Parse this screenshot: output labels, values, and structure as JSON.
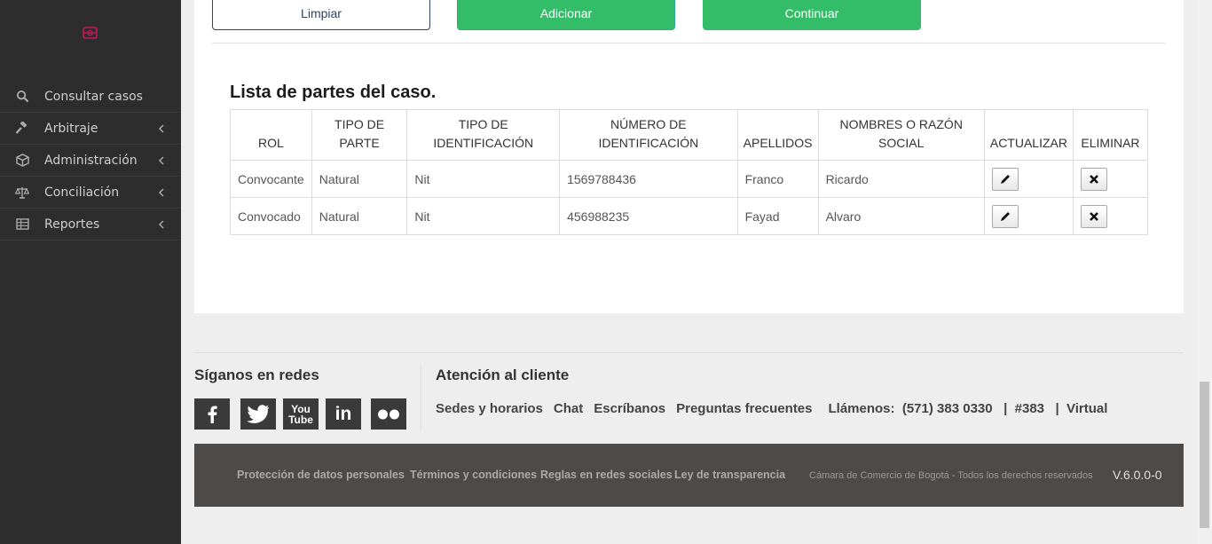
{
  "sidebar": {
    "items": [
      {
        "label": "Consultar casos",
        "icon": "search-icon"
      },
      {
        "label": "Arbitraje",
        "icon": "gavel-icon"
      },
      {
        "label": "Administración",
        "icon": "cube-icon"
      },
      {
        "label": "Conciliación",
        "icon": "scale-icon"
      },
      {
        "label": "Reportes",
        "icon": "table-icon"
      }
    ]
  },
  "actions": {
    "limpiar": "Limpiar",
    "adicionar": "Adicionar",
    "continuar": "Continuar"
  },
  "parts": {
    "title": "Lista de partes del caso.",
    "headers": {
      "rol": "ROL",
      "tipo_parte": "TIPO DE PARTE",
      "tipo_id": "TIPO DE IDENTIFICACIÓN",
      "numero_id": "NÚMERO DE IDENTIFICACIÓN",
      "apellidos": "APELLIDOS",
      "nombres": "NOMBRES O RAZÓN SOCIAL",
      "actualizar": "ACTUALIZAR",
      "eliminar": "ELIMINAR"
    },
    "rows": [
      {
        "rol": "Convocante",
        "tipo_parte": "Natural",
        "tipo_id": "Nit",
        "numero_id": "1569788436",
        "apellidos": "Franco",
        "nombres": "Ricardo"
      },
      {
        "rol": "Convocado",
        "tipo_parte": "Natural",
        "tipo_id": "Nit",
        "numero_id": "456988235",
        "apellidos": "Fayad",
        "nombres": "Alvaro"
      }
    ]
  },
  "footer": {
    "social_title": "Síganos en redes",
    "attention_title": "Atención al cliente",
    "social": [
      "facebook-icon",
      "twitter-icon",
      "youtube-icon",
      "linkedin-icon",
      "flickr-icon"
    ],
    "links": {
      "sedes": "Sedes y horarios",
      "chat": "Chat",
      "escribanos": "Escríbanos",
      "preguntas": "Preguntas frecuentes",
      "llamenos": "Llámenos:  (571) 383 0330   |  #383   |  Virtual"
    },
    "legal": {
      "proteccion": "Protección de datos personales",
      "terminos": "Términos y condiciones",
      "reglas": "Reglas en redes sociales",
      "transparencia": "Ley de transparencia"
    },
    "rights": "Cámara de Comercio de Bogotá - Todos los derechos reservados",
    "version": "V.6.0.0-0"
  }
}
